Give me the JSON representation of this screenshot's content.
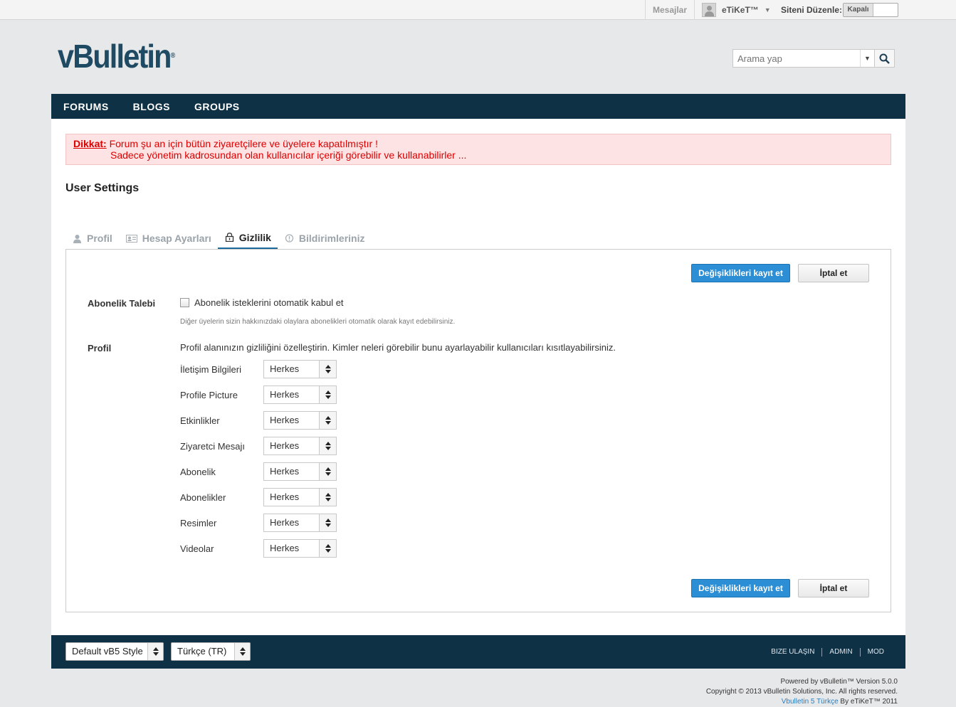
{
  "topbar": {
    "messages": "Mesajlar",
    "username": "eTiKeT™",
    "site_edit_label": "Siteni Düzenle:",
    "toggle_state": "Kapalı"
  },
  "header": {
    "logo_text": "vBulletin",
    "search_placeholder": "Arama yap"
  },
  "nav": {
    "items": [
      "FORUMS",
      "BLOGS",
      "GROUPS"
    ]
  },
  "alert": {
    "title": "Dikkat:",
    "line1": "Forum şu an için bütün ziyaretçilere ve üyelere kapatılmıştır !",
    "line2": "Sadece yönetim kadrosundan olan kullanıcılar içeriği görebilir ve kullanabilirler ..."
  },
  "page_title": "User Settings",
  "tabs": [
    {
      "label": "Profil",
      "icon": "user-icon",
      "active": false
    },
    {
      "label": "Hesap Ayarları",
      "icon": "id-card-icon",
      "active": false
    },
    {
      "label": "Gizlilik",
      "icon": "lock-icon",
      "active": true
    },
    {
      "label": "Bildirimleriniz",
      "icon": "bell-icon",
      "active": false
    }
  ],
  "buttons": {
    "save": "Değişiklikleri kayıt et",
    "cancel": "İptal et"
  },
  "subscription": {
    "label": "Abonelik Talebi",
    "checkbox_label": "Abonelik isteklerini otomatik kabul et",
    "checked": false,
    "hint": "Diğer üyelerin sizin hakkınızdaki olaylara abonelikleri otomatik olarak kayıt edebilirsiniz."
  },
  "profile": {
    "label": "Profil",
    "description": "Profil alanınızın gizliliğini özelleştirin. Kimler neleri görebilir bunu ayarlayabilir kullanıcıları kısıtlayabilirsiniz.",
    "rows": [
      {
        "label": "İletişim Bilgileri",
        "value": "Herkes"
      },
      {
        "label": "Profile Picture",
        "value": "Herkes"
      },
      {
        "label": "Etkinlikler",
        "value": "Herkes"
      },
      {
        "label": "Ziyaretci Mesajı",
        "value": "Herkes"
      },
      {
        "label": "Abonelik",
        "value": "Herkes"
      },
      {
        "label": "Abonelikler",
        "value": "Herkes"
      },
      {
        "label": "Resimler",
        "value": "Herkes"
      },
      {
        "label": "Videolar",
        "value": "Herkes"
      }
    ]
  },
  "footer": {
    "style_select": "Default vB5 Style",
    "language_select": "Türkçe (TR)",
    "links": [
      "BIZE ULAŞIN",
      "ADMIN",
      "MOD"
    ]
  },
  "copyright": {
    "line1": "Powered by vBulletin™ Version 5.0.0",
    "line2": "Copyright © 2013 vBulletin Solutions, Inc. All rights reserved.",
    "line3_link": "Vbulletin 5 Türkçe",
    "line3_rest": " By eTiKeT™ 2011"
  },
  "colors": {
    "nav_bg": "#0f3146",
    "accent": "#2c8fd6",
    "alert_text": "#dd0000",
    "alert_bg": "#fde3e3"
  }
}
